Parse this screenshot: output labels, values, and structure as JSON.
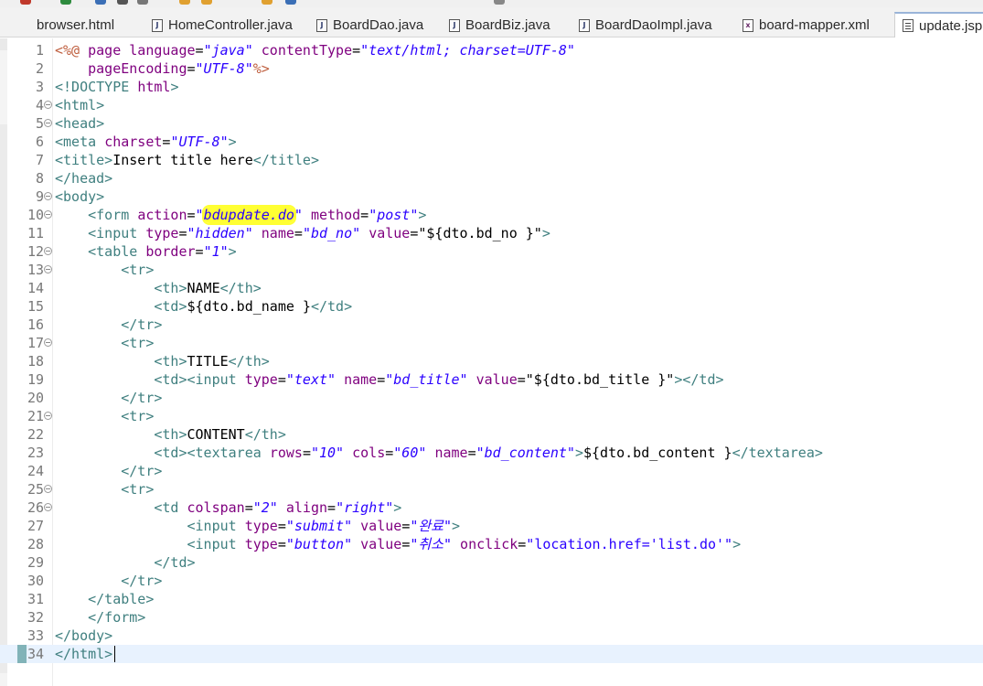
{
  "colors": {
    "tag": "#3f7f7f",
    "attribute": "#7f007f",
    "value": "#2a00ff",
    "directive": "#bf5f3f",
    "text": "#000000",
    "highlight": "#ffff33",
    "current_line": "#e8f2fe",
    "line_number": "#787878"
  },
  "tabs": [
    {
      "label": "browser.html",
      "icon": "html-file-icon",
      "active": false
    },
    {
      "label": "HomeController.java",
      "icon": "java-file-icon",
      "active": false
    },
    {
      "label": "BoardDao.java",
      "icon": "java-file-icon",
      "active": false
    },
    {
      "label": "BoardBiz.java",
      "icon": "java-file-icon",
      "active": false
    },
    {
      "label": "BoardDaoImpl.java",
      "icon": "java-file-icon",
      "active": false
    },
    {
      "label": "board-mapper.xml",
      "icon": "xml-file-icon",
      "active": false
    },
    {
      "label": "update.jsp",
      "icon": "jsp-file-icon",
      "active": true
    }
  ],
  "editor": {
    "current_line": 34,
    "highlighted_text": "bdupdate.do",
    "lines": [
      {
        "n": "1",
        "fold": false,
        "tokens": [
          [
            "d",
            "<%@ "
          ],
          [
            "a",
            "page "
          ],
          [
            "a",
            "language"
          ],
          [
            "p",
            "="
          ],
          [
            "v",
            "\"java\""
          ],
          [
            "p",
            " "
          ],
          [
            "a",
            "contentType"
          ],
          [
            "p",
            "="
          ],
          [
            "v",
            "\"text/html; charset=UTF-8\""
          ]
        ]
      },
      {
        "n": "2",
        "fold": false,
        "tokens": [
          [
            "p",
            "    "
          ],
          [
            "a",
            "pageEncoding"
          ],
          [
            "p",
            "="
          ],
          [
            "v",
            "\"UTF-8\""
          ],
          [
            "d",
            "%>"
          ]
        ]
      },
      {
        "n": "3",
        "fold": false,
        "tokens": [
          [
            "t",
            "<!DOCTYPE "
          ],
          [
            "a",
            "html"
          ],
          [
            "t",
            ">"
          ]
        ]
      },
      {
        "n": "4",
        "fold": true,
        "tokens": [
          [
            "t",
            "<html>"
          ]
        ]
      },
      {
        "n": "5",
        "fold": true,
        "tokens": [
          [
            "t",
            "<head>"
          ]
        ]
      },
      {
        "n": "6",
        "fold": false,
        "tokens": [
          [
            "t",
            "<meta "
          ],
          [
            "a",
            "charset"
          ],
          [
            "p",
            "="
          ],
          [
            "v",
            "\"UTF-8\""
          ],
          [
            "t",
            ">"
          ]
        ]
      },
      {
        "n": "7",
        "fold": false,
        "tokens": [
          [
            "t",
            "<title>"
          ],
          [
            "p",
            "Insert title here"
          ],
          [
            "t",
            "</title>"
          ]
        ]
      },
      {
        "n": "8",
        "fold": false,
        "tokens": [
          [
            "t",
            "</head>"
          ]
        ]
      },
      {
        "n": "9",
        "fold": true,
        "tokens": [
          [
            "t",
            "<body>"
          ]
        ]
      },
      {
        "n": "10",
        "fold": true,
        "tokens": [
          [
            "p",
            "    "
          ],
          [
            "t",
            "<form "
          ],
          [
            "a",
            "action"
          ],
          [
            "p",
            "="
          ],
          [
            "v",
            "\""
          ],
          [
            "h",
            "bdupdate.do"
          ],
          [
            "v",
            "\""
          ],
          [
            "p",
            " "
          ],
          [
            "a",
            "method"
          ],
          [
            "p",
            "="
          ],
          [
            "v",
            "\"post\""
          ],
          [
            "t",
            ">"
          ]
        ]
      },
      {
        "n": "11",
        "fold": false,
        "tokens": [
          [
            "p",
            "    "
          ],
          [
            "t",
            "<input "
          ],
          [
            "a",
            "type"
          ],
          [
            "p",
            "="
          ],
          [
            "v",
            "\"hidden\""
          ],
          [
            "p",
            " "
          ],
          [
            "a",
            "name"
          ],
          [
            "p",
            "="
          ],
          [
            "v",
            "\"bd_no\""
          ],
          [
            "p",
            " "
          ],
          [
            "a",
            "value"
          ],
          [
            "p",
            "=\"${dto.bd_no }\""
          ],
          [
            "t",
            ">"
          ]
        ]
      },
      {
        "n": "12",
        "fold": true,
        "tokens": [
          [
            "p",
            "    "
          ],
          [
            "t",
            "<table "
          ],
          [
            "a",
            "border"
          ],
          [
            "p",
            "="
          ],
          [
            "v",
            "\"1\""
          ],
          [
            "t",
            ">"
          ]
        ]
      },
      {
        "n": "13",
        "fold": true,
        "tokens": [
          [
            "p",
            "        "
          ],
          [
            "t",
            "<tr>"
          ]
        ]
      },
      {
        "n": "14",
        "fold": false,
        "tokens": [
          [
            "p",
            "            "
          ],
          [
            "t",
            "<th>"
          ],
          [
            "p",
            "NAME"
          ],
          [
            "t",
            "</th>"
          ]
        ]
      },
      {
        "n": "15",
        "fold": false,
        "tokens": [
          [
            "p",
            "            "
          ],
          [
            "t",
            "<td>"
          ],
          [
            "p",
            "${dto.bd_name }"
          ],
          [
            "t",
            "</td>"
          ]
        ]
      },
      {
        "n": "16",
        "fold": false,
        "tokens": [
          [
            "p",
            "        "
          ],
          [
            "t",
            "</tr>"
          ]
        ]
      },
      {
        "n": "17",
        "fold": true,
        "tokens": [
          [
            "p",
            "        "
          ],
          [
            "t",
            "<tr>"
          ]
        ]
      },
      {
        "n": "18",
        "fold": false,
        "tokens": [
          [
            "p",
            "            "
          ],
          [
            "t",
            "<th>"
          ],
          [
            "p",
            "TITLE"
          ],
          [
            "t",
            "</th>"
          ]
        ]
      },
      {
        "n": "19",
        "fold": false,
        "tokens": [
          [
            "p",
            "            "
          ],
          [
            "t",
            "<td><input "
          ],
          [
            "a",
            "type"
          ],
          [
            "p",
            "="
          ],
          [
            "v",
            "\"text\""
          ],
          [
            "p",
            " "
          ],
          [
            "a",
            "name"
          ],
          [
            "p",
            "="
          ],
          [
            "v",
            "\"bd_title\""
          ],
          [
            "p",
            " "
          ],
          [
            "a",
            "value"
          ],
          [
            "p",
            "=\"${dto.bd_title }\""
          ],
          [
            "t",
            "></td>"
          ]
        ]
      },
      {
        "n": "20",
        "fold": false,
        "tokens": [
          [
            "p",
            "        "
          ],
          [
            "t",
            "</tr>"
          ]
        ]
      },
      {
        "n": "21",
        "fold": true,
        "tokens": [
          [
            "p",
            "        "
          ],
          [
            "t",
            "<tr>"
          ]
        ]
      },
      {
        "n": "22",
        "fold": false,
        "tokens": [
          [
            "p",
            "            "
          ],
          [
            "t",
            "<th>"
          ],
          [
            "p",
            "CONTENT"
          ],
          [
            "t",
            "</th>"
          ]
        ]
      },
      {
        "n": "23",
        "fold": false,
        "tokens": [
          [
            "p",
            "            "
          ],
          [
            "t",
            "<td><textarea "
          ],
          [
            "a",
            "rows"
          ],
          [
            "p",
            "="
          ],
          [
            "v",
            "\"10\""
          ],
          [
            "p",
            " "
          ],
          [
            "a",
            "cols"
          ],
          [
            "p",
            "="
          ],
          [
            "v",
            "\"60\""
          ],
          [
            "p",
            " "
          ],
          [
            "a",
            "name"
          ],
          [
            "p",
            "="
          ],
          [
            "v",
            "\"bd_content\""
          ],
          [
            "t",
            ">"
          ],
          [
            "p",
            "${dto.bd_content }"
          ],
          [
            "t",
            "</textarea>"
          ]
        ]
      },
      {
        "n": "24",
        "fold": false,
        "tokens": [
          [
            "p",
            "        "
          ],
          [
            "t",
            "</tr>"
          ]
        ]
      },
      {
        "n": "25",
        "fold": true,
        "tokens": [
          [
            "p",
            "        "
          ],
          [
            "t",
            "<tr>"
          ]
        ]
      },
      {
        "n": "26",
        "fold": true,
        "tokens": [
          [
            "p",
            "            "
          ],
          [
            "t",
            "<td "
          ],
          [
            "a",
            "colspan"
          ],
          [
            "p",
            "="
          ],
          [
            "v",
            "\"2\""
          ],
          [
            "p",
            " "
          ],
          [
            "a",
            "align"
          ],
          [
            "p",
            "="
          ],
          [
            "v",
            "\"right\""
          ],
          [
            "t",
            ">"
          ]
        ]
      },
      {
        "n": "27",
        "fold": false,
        "tokens": [
          [
            "p",
            "                "
          ],
          [
            "t",
            "<input "
          ],
          [
            "a",
            "type"
          ],
          [
            "p",
            "="
          ],
          [
            "v",
            "\"submit\""
          ],
          [
            "p",
            " "
          ],
          [
            "a",
            "value"
          ],
          [
            "p",
            "="
          ],
          [
            "v",
            "\"완료\""
          ],
          [
            "t",
            ">"
          ]
        ]
      },
      {
        "n": "28",
        "fold": false,
        "tokens": [
          [
            "p",
            "                "
          ],
          [
            "t",
            "<input "
          ],
          [
            "a",
            "type"
          ],
          [
            "p",
            "="
          ],
          [
            "v",
            "\"button\""
          ],
          [
            "p",
            " "
          ],
          [
            "a",
            "value"
          ],
          [
            "p",
            "="
          ],
          [
            "v",
            "\"취소\""
          ],
          [
            "p",
            " "
          ],
          [
            "a",
            "onclick"
          ],
          [
            "p",
            "="
          ],
          [
            "u",
            "\"location.href='list.do'\""
          ],
          [
            "t",
            ">"
          ]
        ]
      },
      {
        "n": "29",
        "fold": false,
        "tokens": [
          [
            "p",
            "            "
          ],
          [
            "t",
            "</td>"
          ]
        ]
      },
      {
        "n": "30",
        "fold": false,
        "tokens": [
          [
            "p",
            "        "
          ],
          [
            "t",
            "</tr>"
          ]
        ]
      },
      {
        "n": "31",
        "fold": false,
        "tokens": [
          [
            "p",
            "    "
          ],
          [
            "t",
            "</table>"
          ]
        ]
      },
      {
        "n": "32",
        "fold": false,
        "tokens": [
          [
            "p",
            "    "
          ],
          [
            "t",
            "</form>"
          ]
        ]
      },
      {
        "n": "33",
        "fold": false,
        "tokens": [
          [
            "t",
            "</body>"
          ]
        ]
      },
      {
        "n": "34",
        "fold": false,
        "tokens": [
          [
            "t",
            "</html>"
          ]
        ]
      }
    ]
  }
}
